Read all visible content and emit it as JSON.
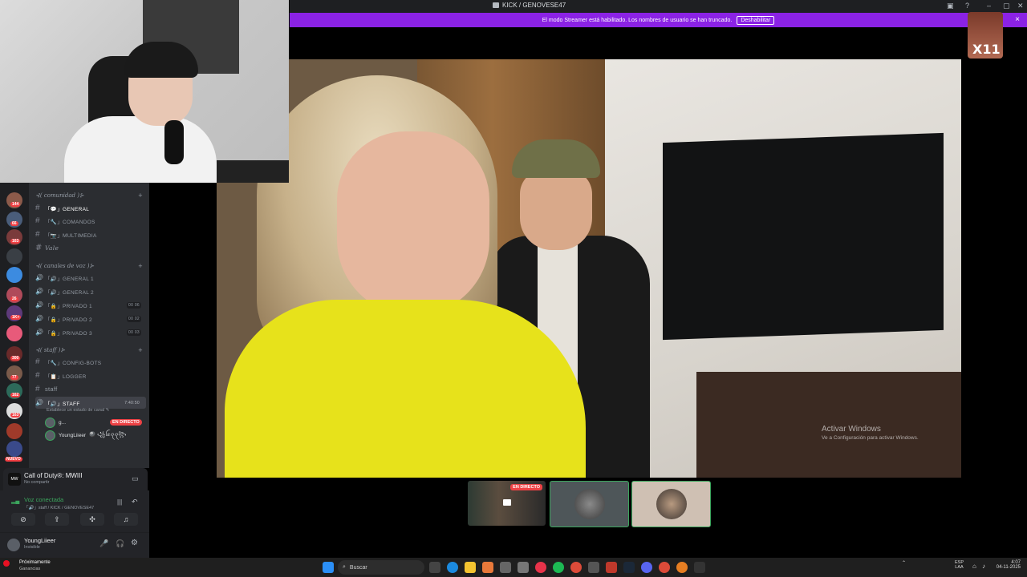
{
  "window": {
    "title": "KICK / GENOVESE47",
    "controls": [
      "inbox-icon",
      "help-icon",
      "minimize-icon",
      "maximize-icon",
      "close-icon"
    ]
  },
  "banner": {
    "text": "El modo Streamer está habilitado. Los nombres de usuario se han truncado.",
    "button": "Deshabilitar",
    "close": "×"
  },
  "guilds": {
    "badges": [
      "144",
      "66",
      "163",
      "42",
      "26",
      "1K+",
      "300",
      "77",
      "162",
      "163"
    ],
    "new_label": "NUEVO"
  },
  "categories": {
    "comunidad": "⊰( comunidad )⊱",
    "canales_voz": "⊰( canales de voz )⊱",
    "staff": "⊰( staff )⊱"
  },
  "channels": {
    "text1": [
      "「💬」general",
      "「🔧」comandos",
      "「📷」multimedia"
    ],
    "vale": "Vale",
    "voice": [
      {
        "label": "「🔊」general 1",
        "count": ""
      },
      {
        "label": "「🔊」general 2",
        "count": ""
      },
      {
        "label": "「🔒」privado 1",
        "count": "00 06"
      },
      {
        "label": "「🔒」privado 2",
        "count": "00 02"
      },
      {
        "label": "「🔒」privado 3",
        "count": "00 03"
      }
    ],
    "staff_text": [
      "「🔧」config-bots",
      "「📋」logger"
    ],
    "staff_plain": "staff",
    "staff_voice": {
      "label": "「🔊」staff",
      "time": "7:40:50"
    },
    "status_hint": "Establece un estado de canal ✎",
    "users": [
      {
        "name": "g...",
        "live": "EN DIRECTO"
      },
      {
        "name": "YoungLiieer",
        "extra": "🎱 ꧁ꪶꫀꪖꪖ꧂"
      }
    ]
  },
  "activity": {
    "name": "Call of Duty®: MWIII",
    "sub": "No compartir"
  },
  "voice": {
    "status": "Voz conectada",
    "location": "「🔊」staff / KICK / GENOVESE47"
  },
  "user": {
    "name": "YoungLiieer",
    "status": "Invisible"
  },
  "stage": {
    "watermark_title": "Activar Windows",
    "watermark_sub": "Ve a Configuración para activar Windows."
  },
  "thumbs": {
    "live_label": "EN DIRECTO"
  },
  "badge": {
    "text": "X11"
  },
  "taskbar": {
    "weather_title": "Próximamente",
    "weather_sub": "Ganancias",
    "search_placeholder": "Buscar",
    "lang": "ESP",
    "lang2": "LAA",
    "time": "4:07",
    "date": "04-11-2025"
  }
}
